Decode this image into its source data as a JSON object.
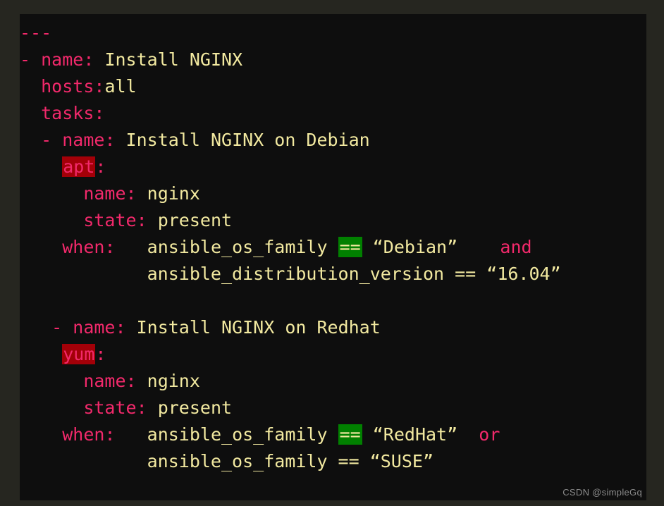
{
  "theme": {
    "outer_background": "#262620",
    "code_background": "#0e0e0e",
    "key_color": "#f2296b",
    "value_color": "#f2e9a0",
    "highlight_module_background": "#a30008",
    "highlight_module_color": "#f2296b",
    "highlight_operator_background": "#018000",
    "highlight_operator_color": "#f2e9a0",
    "watermark_color": "#8c8c8c"
  },
  "code": {
    "language": "yaml",
    "lines": [
      {
        "id": "l1",
        "indent": "",
        "key": "---",
        "colon": "",
        "value": "",
        "key_style": "plain-key"
      },
      {
        "id": "l2",
        "indent": "- ",
        "key": "name",
        "colon": ":",
        "value": " Install NGINX",
        "key_style": "key"
      },
      {
        "id": "l3",
        "indent": "  ",
        "key": "hosts",
        "colon": ":",
        "value": "all",
        "key_style": "key"
      },
      {
        "id": "l4",
        "indent": "  ",
        "key": "tasks",
        "colon": ":",
        "value": "",
        "key_style": "key"
      },
      {
        "id": "l5",
        "indent": "  - ",
        "key": "name",
        "colon": ":",
        "value": " Install NGINX on Debian",
        "key_style": "key"
      },
      {
        "id": "l6",
        "indent": "    ",
        "key": "apt",
        "colon": ":",
        "value": "",
        "key_style": "highlight-red"
      },
      {
        "id": "l7",
        "indent": "      ",
        "key": "name",
        "colon": ":",
        "value": " nginx",
        "key_style": "key"
      },
      {
        "id": "l8",
        "indent": "      ",
        "key": "state",
        "colon": ":",
        "value": " present",
        "key_style": "key"
      },
      {
        "id": "l9",
        "indent": "    ",
        "key": "when",
        "colon": ":",
        "value": "",
        "key_style": "key"
      },
      {
        "id": "l10",
        "indent": "",
        "key": "",
        "colon": "",
        "value": "",
        "key_style": "blank"
      },
      {
        "id": "l11",
        "indent": "   - ",
        "key": "name",
        "colon": ":",
        "value": " Install NGINX on Redhat",
        "key_style": "key"
      },
      {
        "id": "l12",
        "indent": "    ",
        "key": "yum",
        "colon": ":",
        "value": "",
        "key_style": "highlight-red"
      },
      {
        "id": "l13",
        "indent": "      ",
        "key": "name",
        "colon": ":",
        "value": " nginx",
        "key_style": "key"
      },
      {
        "id": "l14",
        "indent": "      ",
        "key": "state",
        "colon": ":",
        "value": " present",
        "key_style": "key"
      },
      {
        "id": "l15",
        "indent": "    ",
        "key": "when",
        "colon": ":",
        "value": "",
        "key_style": "key"
      }
    ]
  },
  "conditions": {
    "debian": {
      "indent_first": "    ",
      "keyword": "when",
      "colon": ":",
      "gap": "   ",
      "lhs": "ansible_os_family ",
      "operator": "==",
      "rhs": " “Debian”",
      "joiner_gap": "    ",
      "joiner": "and",
      "continuation_indent": "            ",
      "continuation": "ansible_distribution_version == “16.04”"
    },
    "redhat": {
      "indent_first": "    ",
      "keyword": "when",
      "colon": ":",
      "gap": "   ",
      "lhs": "ansible_os_family ",
      "operator": "==",
      "rhs": " “RedHat”",
      "joiner_gap": "  ",
      "joiner": "or",
      "continuation_indent": "            ",
      "continuation": "ansible_os_family == “SUSE”"
    }
  },
  "watermark": {
    "text": "CSDN @simpleGq"
  }
}
